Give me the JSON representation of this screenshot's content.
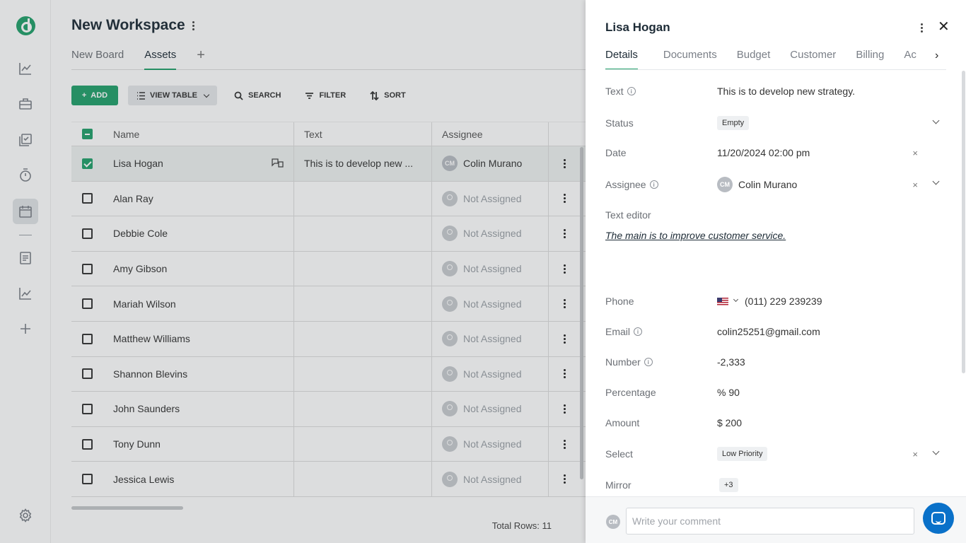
{
  "workspace": {
    "title": "New Workspace"
  },
  "board_tabs": [
    {
      "label": "New Board",
      "active": false
    },
    {
      "label": "Assets",
      "active": true
    }
  ],
  "add_tab_symbol": "+",
  "toolbar": {
    "add_label": "ADD",
    "view_label": "VIEW TABLE",
    "search_label": "SEARCH",
    "filter_label": "FILTER",
    "sort_label": "SORT"
  },
  "table": {
    "headers": {
      "name": "Name",
      "text": "Text",
      "assignee": "Assignee"
    },
    "rows": [
      {
        "name": "Lisa Hogan",
        "text": "This is to develop new ...",
        "assignee": "Colin Murano",
        "assignee_initials": "CM",
        "selected": true
      },
      {
        "name": "Alan Ray",
        "text": "",
        "assignee": "Not Assigned"
      },
      {
        "name": "Debbie Cole",
        "text": "",
        "assignee": "Not Assigned"
      },
      {
        "name": "Amy Gibson",
        "text": "",
        "assignee": "Not Assigned"
      },
      {
        "name": "Mariah Wilson",
        "text": "",
        "assignee": "Not Assigned"
      },
      {
        "name": "Matthew Williams",
        "text": "",
        "assignee": "Not Assigned"
      },
      {
        "name": "Shannon Blevins",
        "text": "",
        "assignee": "Not Assigned"
      },
      {
        "name": "John Saunders",
        "text": "",
        "assignee": "Not Assigned"
      },
      {
        "name": "Tony Dunn",
        "text": "",
        "assignee": "Not Assigned"
      },
      {
        "name": "Jessica Lewis",
        "text": "",
        "assignee": "Not Assigned"
      }
    ],
    "total_rows": "Total Rows: 11"
  },
  "panel": {
    "title": "Lisa Hogan",
    "tabs": [
      "Details",
      "Documents",
      "Budget",
      "Customer",
      "Billing",
      "Ac"
    ],
    "active_tab": "Details",
    "fields": {
      "text": {
        "label": "Text",
        "value": "This is to develop new strategy."
      },
      "status": {
        "label": "Status",
        "value": "Empty"
      },
      "date": {
        "label": "Date",
        "value": "11/20/2024 02:00 pm"
      },
      "assignee": {
        "label": "Assignee",
        "value": "Colin Murano",
        "initials": "CM"
      },
      "text_editor": {
        "label": "Text editor",
        "value": "The main is to improve customer service."
      },
      "phone": {
        "label": "Phone",
        "value": "(011) 229 239239"
      },
      "email": {
        "label": "Email",
        "value": "colin25251@gmail.com"
      },
      "number": {
        "label": "Number",
        "value": "-2,333"
      },
      "percentage": {
        "label": "Percentage",
        "value": "% 90"
      },
      "amount": {
        "label": "Amount",
        "value": "$ 200"
      },
      "select": {
        "label": "Select",
        "value": "Low Priority"
      },
      "mirror": {
        "label": "Mirror",
        "value": "+3"
      }
    },
    "comment": {
      "avatar_initials": "CM",
      "placeholder": "Write your comment"
    },
    "clear_symbol": "×",
    "close_symbol": "✕",
    "next_symbol": "›"
  },
  "colors": {
    "accent": "#22a06b",
    "chat": "#0a71c9"
  },
  "icons": [
    "logo-icon",
    "analytics-icon",
    "briefcase-icon",
    "tasks-icon",
    "timer-icon",
    "calendar-icon",
    "document-icon",
    "chart-icon",
    "plus-icon",
    "settings-icon"
  ]
}
